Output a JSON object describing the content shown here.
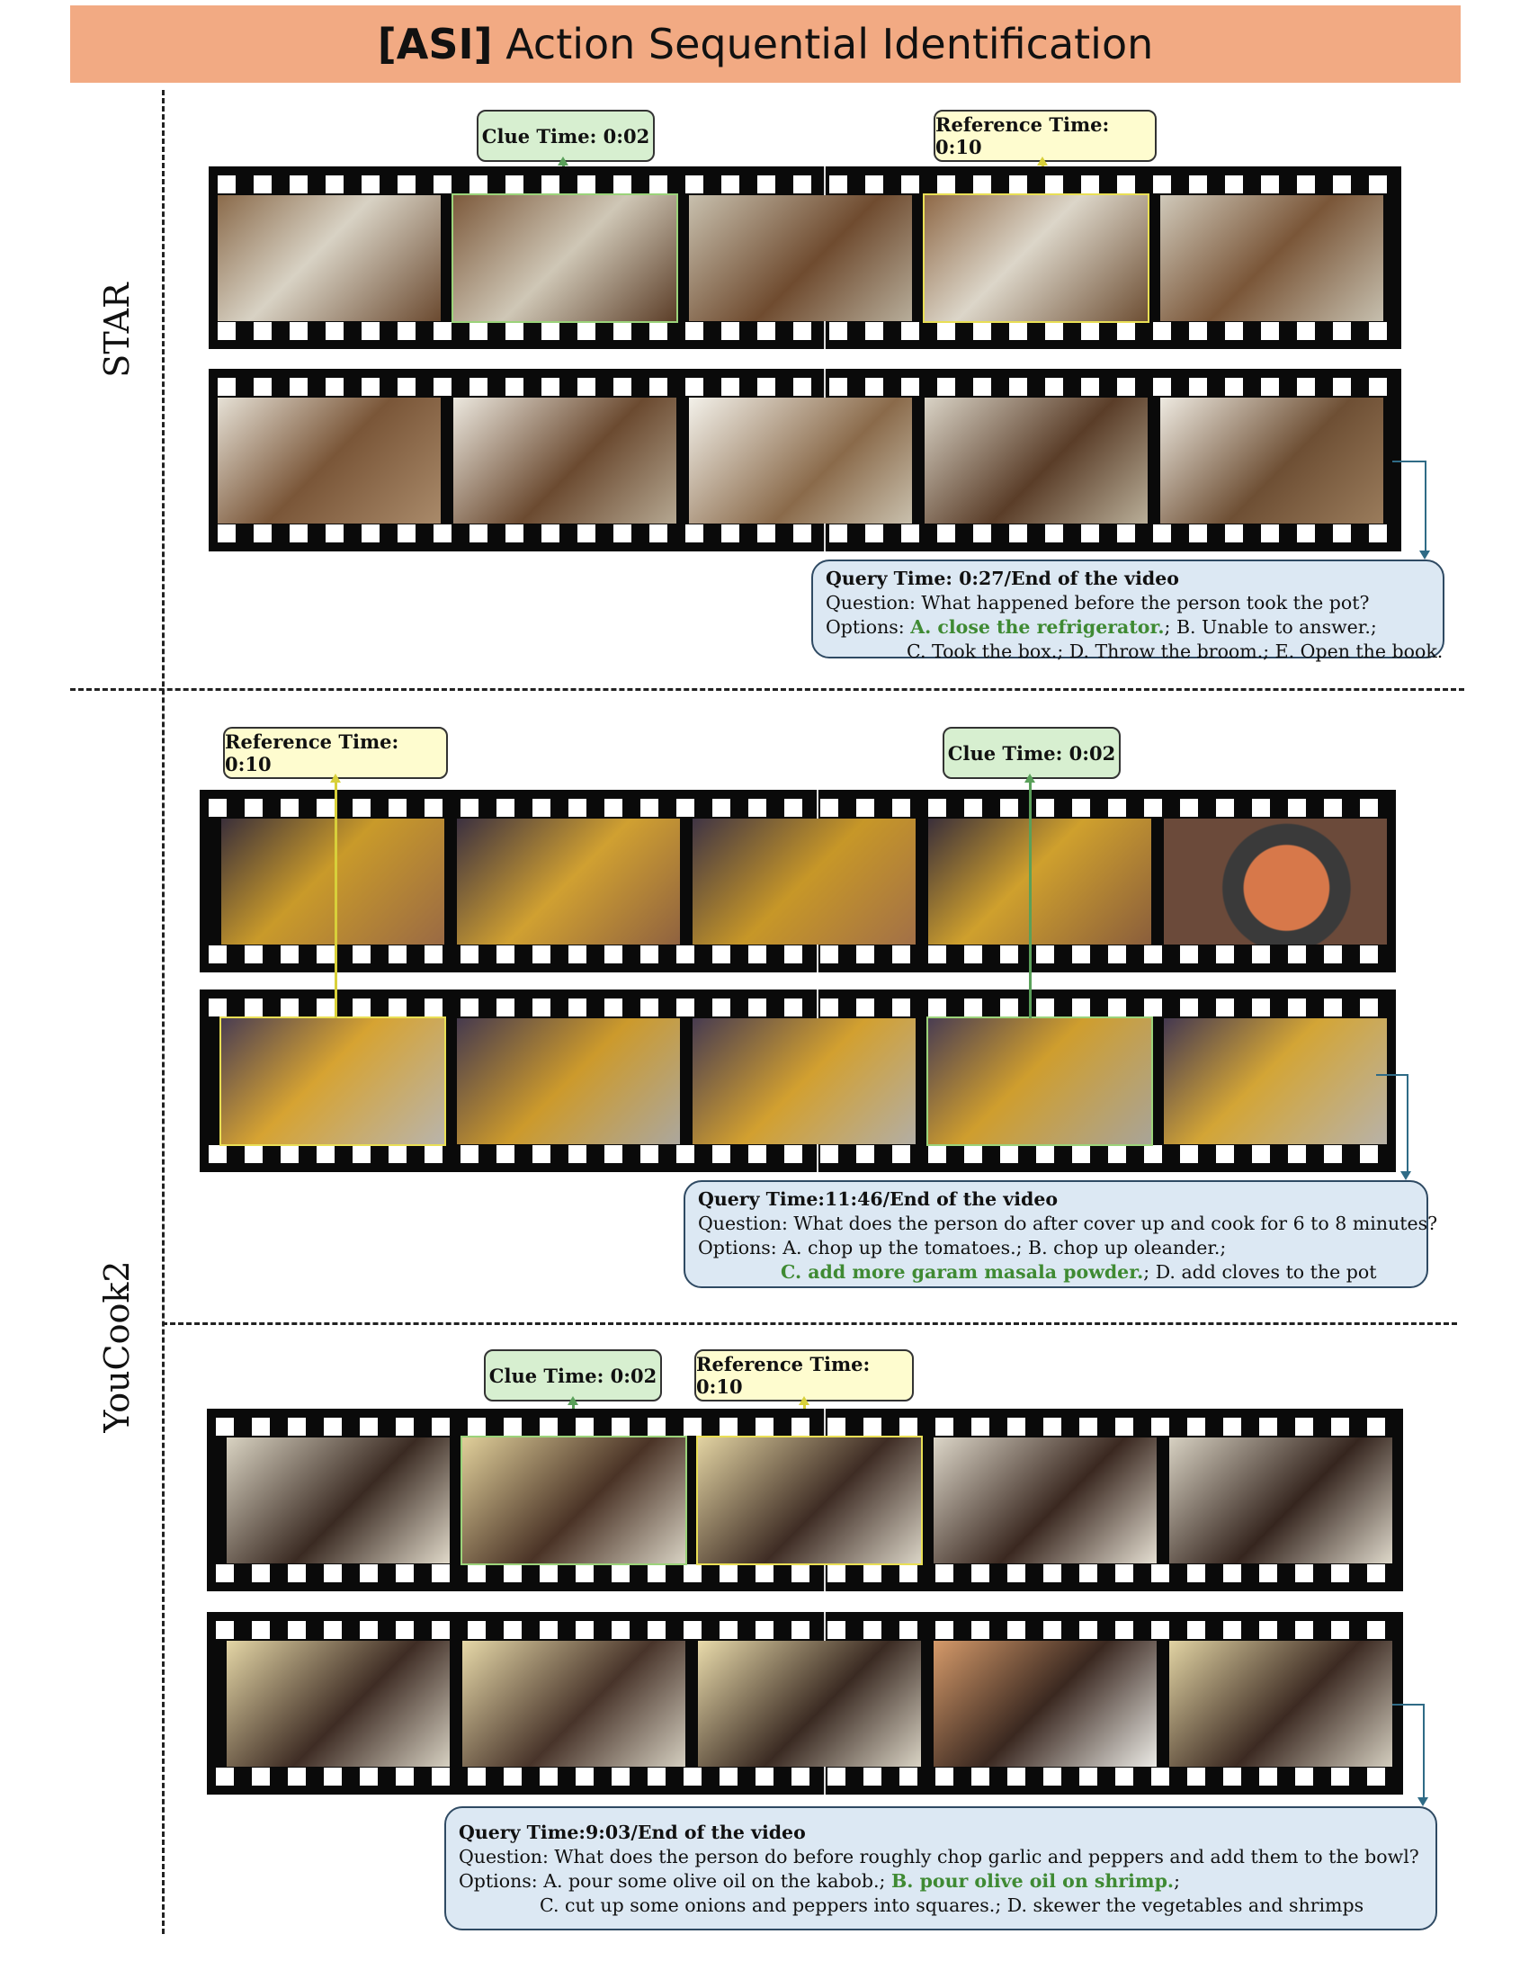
{
  "header": {
    "bracket": "[ASI]",
    "title": " Action Sequential Identification"
  },
  "side_labels": {
    "star": "STAR",
    "youcook": "YouCook2"
  },
  "star": {
    "clue": "Clue Time: 0:02",
    "reference": "Reference Time: 0:10",
    "query_title": "Query Time: 0:27/End of the video",
    "question": "Question: What happened before the person took the pot?",
    "options_prefix": "Options: ",
    "answer": "A. close the refrigerator.",
    "options_rest1": "; B. Unable to answer.;",
    "options_line2": "C. Took the box.; D. Throw the broom.; E. Open the book."
  },
  "youcook1": {
    "reference": "Reference Time: 0:10",
    "clue": "Clue Time: 0:02",
    "query_title": "Query Time:11:46/End of the video",
    "question": "Question: What does the person do after cover up and cook for 6 to 8 minutes?",
    "options_line1": "Options: A. chop up the tomatoes.; B. chop up oleander.;",
    "answer": "C. add more garam masala powder.",
    "options_rest2": "; D. add cloves to the pot"
  },
  "youcook2": {
    "clue": "Clue Time: 0:02",
    "reference": "Reference Time: 0:10",
    "query_title": "Query Time:9:03/End of the video",
    "question": "Question: What does the person do before roughly chop garlic and peppers and add them to the bowl?",
    "options_prefix": "Options: A. pour some olive oil on the kabob.; ",
    "answer": "B. pour olive oil on shrimp.",
    "options_rest1": ";",
    "options_line2": "C. cut up some onions and peppers into squares.; D. skewer the vegetables and shrimps"
  },
  "colors": {
    "header_bg": "#f2aa83",
    "clue_bg": "#d7efd0",
    "reference_bg": "#fefccf",
    "query_bg": "#dce8f3",
    "answer_text": "#3f8a33"
  }
}
